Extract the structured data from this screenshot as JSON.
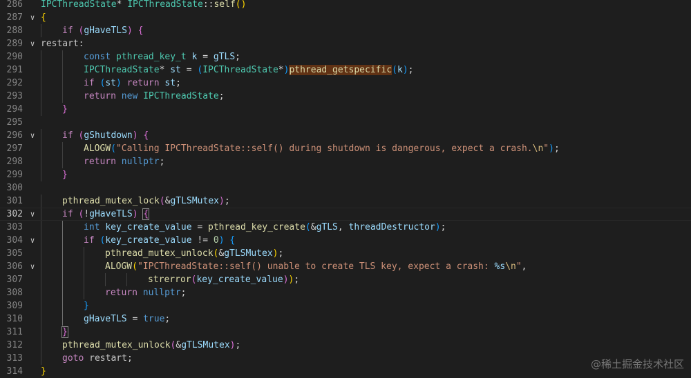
{
  "editor": {
    "lines": [
      {
        "n": "286",
        "fold": "",
        "indent": 0,
        "tokens": [
          [
            "typ",
            "IPCThreadState"
          ],
          [
            "",
            "* "
          ],
          [
            "typ",
            "IPCThreadState"
          ],
          [
            "",
            "::"
          ],
          [
            "fn",
            "self"
          ],
          [
            "br1",
            "()"
          ]
        ]
      },
      {
        "n": "287",
        "fold": "v",
        "indent": 0,
        "tokens": [
          [
            "br1",
            "{"
          ]
        ]
      },
      {
        "n": "288",
        "fold": "",
        "indent": 1,
        "tokens": [
          [
            "ctl",
            "if"
          ],
          [
            "",
            " "
          ],
          [
            "br2",
            "("
          ],
          [
            "var",
            "gHaveTLS"
          ],
          [
            "br2",
            ")"
          ],
          [
            "",
            " "
          ],
          [
            "br2",
            "{"
          ]
        ]
      },
      {
        "n": "289",
        "fold": "v",
        "indent": 0,
        "tokens": [
          [
            "lbl",
            "restart:"
          ]
        ]
      },
      {
        "n": "290",
        "fold": "",
        "indent": 2,
        "tokens": [
          [
            "kw",
            "const"
          ],
          [
            "",
            " "
          ],
          [
            "typ",
            "pthread_key_t"
          ],
          [
            "",
            " "
          ],
          [
            "var",
            "k"
          ],
          [
            "",
            " = "
          ],
          [
            "var",
            "gTLS"
          ],
          [
            "",
            ";"
          ]
        ]
      },
      {
        "n": "291",
        "fold": "",
        "indent": 2,
        "tokens": [
          [
            "typ",
            "IPCThreadState"
          ],
          [
            "",
            "* "
          ],
          [
            "var",
            "st"
          ],
          [
            "",
            " = "
          ],
          [
            "br3",
            "("
          ],
          [
            "typ",
            "IPCThreadState"
          ],
          [
            "",
            "*"
          ],
          [
            "br3",
            ")"
          ],
          [
            "fn hl",
            "pthread_getspecific"
          ],
          [
            "br3",
            "("
          ],
          [
            "var",
            "k"
          ],
          [
            "br3",
            ")"
          ],
          [
            "",
            ";"
          ]
        ]
      },
      {
        "n": "292",
        "fold": "",
        "indent": 2,
        "tokens": [
          [
            "ctl",
            "if"
          ],
          [
            "",
            " "
          ],
          [
            "br3",
            "("
          ],
          [
            "var",
            "st"
          ],
          [
            "br3",
            ")"
          ],
          [
            "",
            " "
          ],
          [
            "ctl",
            "return"
          ],
          [
            "",
            " "
          ],
          [
            "var",
            "st"
          ],
          [
            "",
            ";"
          ]
        ]
      },
      {
        "n": "293",
        "fold": "",
        "indent": 2,
        "tokens": [
          [
            "ctl",
            "return"
          ],
          [
            "",
            " "
          ],
          [
            "kw",
            "new"
          ],
          [
            "",
            " "
          ],
          [
            "typ",
            "IPCThreadState"
          ],
          [
            "",
            ";"
          ]
        ]
      },
      {
        "n": "294",
        "fold": "",
        "indent": 1,
        "tokens": [
          [
            "br2",
            "}"
          ]
        ]
      },
      {
        "n": "295",
        "fold": "",
        "indent": 0,
        "tokens": []
      },
      {
        "n": "296",
        "fold": "v",
        "indent": 1,
        "tokens": [
          [
            "ctl",
            "if"
          ],
          [
            "",
            " "
          ],
          [
            "br2",
            "("
          ],
          [
            "var",
            "gShutdown"
          ],
          [
            "br2",
            ")"
          ],
          [
            "",
            " "
          ],
          [
            "br2",
            "{"
          ]
        ]
      },
      {
        "n": "297",
        "fold": "",
        "indent": 2,
        "tokens": [
          [
            "mac",
            "ALOGW"
          ],
          [
            "br3",
            "("
          ],
          [
            "str",
            "\"Calling IPCThreadState::self() during shutdown is dangerous, expect a crash."
          ],
          [
            "esc",
            "\\n"
          ],
          [
            "str",
            "\""
          ],
          [
            "br3",
            ")"
          ],
          [
            "",
            ";"
          ]
        ]
      },
      {
        "n": "298",
        "fold": "",
        "indent": 2,
        "tokens": [
          [
            "ctl",
            "return"
          ],
          [
            "",
            " "
          ],
          [
            "kw",
            "nullptr"
          ],
          [
            "",
            ";"
          ]
        ]
      },
      {
        "n": "299",
        "fold": "",
        "indent": 1,
        "tokens": [
          [
            "br2",
            "}"
          ]
        ]
      },
      {
        "n": "300",
        "fold": "",
        "indent": 0,
        "tokens": []
      },
      {
        "n": "301",
        "fold": "",
        "indent": 1,
        "tokens": [
          [
            "fn",
            "pthread_mutex_lock"
          ],
          [
            "br2",
            "("
          ],
          [
            "",
            "&"
          ],
          [
            "var",
            "gTLSMutex"
          ],
          [
            "br2",
            ")"
          ],
          [
            "",
            ";"
          ]
        ]
      },
      {
        "n": "302",
        "fold": "v",
        "indent": 1,
        "active": true,
        "tokens": [
          [
            "ctl",
            "if"
          ],
          [
            "",
            " "
          ],
          [
            "br2",
            "("
          ],
          [
            "",
            "!"
          ],
          [
            "var",
            "gHaveTLS"
          ],
          [
            "br2",
            ")"
          ],
          [
            "",
            " "
          ],
          [
            "br2 brmatch",
            "{"
          ]
        ]
      },
      {
        "n": "303",
        "fold": "",
        "indent": 2,
        "tokens": [
          [
            "kw",
            "int"
          ],
          [
            "",
            " "
          ],
          [
            "var",
            "key_create_value"
          ],
          [
            "",
            " = "
          ],
          [
            "fn",
            "pthread_key_create"
          ],
          [
            "br3",
            "("
          ],
          [
            "",
            "&"
          ],
          [
            "var",
            "gTLS"
          ],
          [
            "",
            ", "
          ],
          [
            "var",
            "threadDestructor"
          ],
          [
            "br3",
            ")"
          ],
          [
            "",
            ";"
          ]
        ]
      },
      {
        "n": "304",
        "fold": "v",
        "indent": 2,
        "tokens": [
          [
            "ctl",
            "if"
          ],
          [
            "",
            " "
          ],
          [
            "br3",
            "("
          ],
          [
            "var",
            "key_create_value"
          ],
          [
            "",
            " != "
          ],
          [
            "num",
            "0"
          ],
          [
            "br3",
            ")"
          ],
          [
            "",
            " "
          ],
          [
            "br3",
            "{"
          ]
        ]
      },
      {
        "n": "305",
        "fold": "",
        "indent": 3,
        "tokens": [
          [
            "fn",
            "pthread_mutex_unlock"
          ],
          [
            "br1",
            "("
          ],
          [
            "",
            "&"
          ],
          [
            "var",
            "gTLSMutex"
          ],
          [
            "br1",
            ")"
          ],
          [
            "",
            ";"
          ]
        ]
      },
      {
        "n": "306",
        "fold": "v",
        "indent": 3,
        "tokens": [
          [
            "mac",
            "ALOGW"
          ],
          [
            "br1",
            "("
          ],
          [
            "str",
            "\"IPCThreadState::self() unable to create TLS key, expect a crash: "
          ],
          [
            "fmt",
            "%s"
          ],
          [
            "esc",
            "\\n"
          ],
          [
            "str",
            "\""
          ],
          [
            "",
            ","
          ]
        ]
      },
      {
        "n": "307",
        "fold": "",
        "indent": 5,
        "tokens": [
          [
            "fn",
            "strerror"
          ],
          [
            "br2",
            "("
          ],
          [
            "var",
            "key_create_value"
          ],
          [
            "br2",
            ")"
          ],
          [
            "br1",
            ")"
          ],
          [
            "",
            ";"
          ]
        ]
      },
      {
        "n": "308",
        "fold": "",
        "indent": 3,
        "tokens": [
          [
            "ctl",
            "return"
          ],
          [
            "",
            " "
          ],
          [
            "kw",
            "nullptr"
          ],
          [
            "",
            ";"
          ]
        ]
      },
      {
        "n": "309",
        "fold": "",
        "indent": 2,
        "tokens": [
          [
            "br3",
            "}"
          ]
        ]
      },
      {
        "n": "310",
        "fold": "",
        "indent": 2,
        "tokens": [
          [
            "var",
            "gHaveTLS"
          ],
          [
            "",
            " = "
          ],
          [
            "kw",
            "true"
          ],
          [
            "",
            ";"
          ]
        ]
      },
      {
        "n": "311",
        "fold": "",
        "indent": 1,
        "tokens": [
          [
            "br2 brmatch",
            "}"
          ]
        ]
      },
      {
        "n": "312",
        "fold": "",
        "indent": 1,
        "tokens": [
          [
            "fn",
            "pthread_mutex_unlock"
          ],
          [
            "br2",
            "("
          ],
          [
            "",
            "&"
          ],
          [
            "var",
            "gTLSMutex"
          ],
          [
            "br2",
            ")"
          ],
          [
            "",
            ";"
          ]
        ]
      },
      {
        "n": "313",
        "fold": "",
        "indent": 1,
        "tokens": [
          [
            "ctl",
            "goto"
          ],
          [
            "",
            " "
          ],
          [
            "lbl",
            "restart"
          ],
          [
            "",
            ";"
          ]
        ]
      },
      {
        "n": "314",
        "fold": "",
        "indent": 0,
        "tokens": [
          [
            "br1",
            "}"
          ]
        ]
      }
    ]
  },
  "watermark": {
    "text": "@稀土掘金技术社区"
  }
}
